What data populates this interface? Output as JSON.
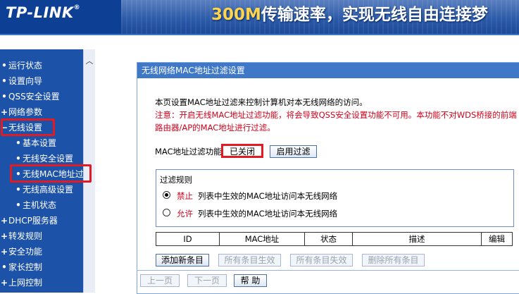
{
  "header": {
    "logo": "TP-LINK",
    "logo_reg": "®",
    "slogan_num": "300M",
    "slogan_text": "传输速率，实现无线自由连接梦"
  },
  "sidebar": {
    "items": [
      {
        "label": "运行状态",
        "bullet": "•"
      },
      {
        "label": "设置向导",
        "bullet": "•"
      },
      {
        "label": "QSS安全设置",
        "bullet": "•"
      },
      {
        "label": "网络参数",
        "bullet": "+"
      },
      {
        "label": "无线设置",
        "bullet": "−"
      },
      {
        "label": "基本设置",
        "bullet": "•"
      },
      {
        "label": "无线安全设置",
        "bullet": "•"
      },
      {
        "label": "无线MAC地址过滤",
        "bullet": "•"
      },
      {
        "label": "无线高级设置",
        "bullet": "•"
      },
      {
        "label": "主机状态",
        "bullet": "•"
      },
      {
        "label": "DHCP服务器",
        "bullet": "+"
      },
      {
        "label": "转发规则",
        "bullet": "+"
      },
      {
        "label": "安全功能",
        "bullet": "+"
      },
      {
        "label": "家长控制",
        "bullet": "•"
      },
      {
        "label": "上网控制",
        "bullet": "+"
      }
    ]
  },
  "panel": {
    "title": "无线网络MAC地址过滤设置",
    "intro": "本页设置MAC地址过滤来控制计算机对本无线网络的访问。",
    "note_line1": "注意：开启无线MAC地址过滤功能，将会导致QSS安全设置功能不可用。本功能不对WDS桥接的前端",
    "note_line2": "路由器/AP的MAC地址进行过滤。",
    "filter_label": "MAC地址过滤功能：",
    "filter_status": "已关闭",
    "enable_button": "启用过滤",
    "rules_title": "过滤规则",
    "rule_deny_label": "禁止",
    "rule_deny_text": "列表中生效的MAC地址访问本无线网络",
    "rule_allow_label": "允许",
    "rule_allow_text": "列表中生效的MAC地址访问本无线网络",
    "table_headers": [
      "ID",
      "MAC地址",
      "状态",
      "描述",
      "编辑"
    ],
    "buttons": {
      "add": "添加新条目",
      "enable_all": "所有条目生效",
      "disable_all": "所有条目失效",
      "delete_all": "删除所有条目",
      "prev": "上一页",
      "next": "下一页",
      "help": "帮 助"
    }
  },
  "colors": {
    "accent": "#3f78c7",
    "sidebar": "#1c52a8",
    "highlight": "#e01b24",
    "warning": "#d0021b"
  }
}
